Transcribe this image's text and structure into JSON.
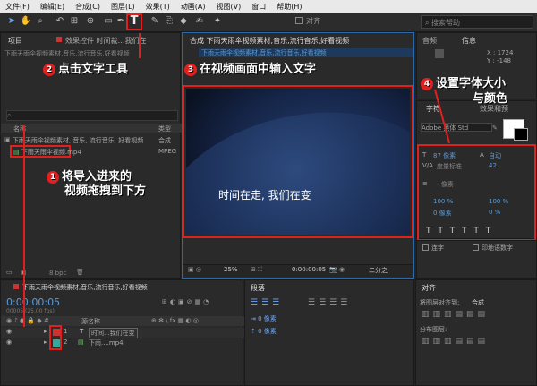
{
  "menu": [
    "文件(F)",
    "编辑(E)",
    "合成(C)",
    "图层(L)",
    "效果(T)",
    "动画(A)",
    "视图(V)",
    "窗口",
    "帮助(H)"
  ],
  "toolbar": {
    "align_label": "对齐",
    "search_placeholder": "搜索帮助"
  },
  "project_panel": {
    "tab": "项目",
    "effects_tab": "效果控件 时间裁…我们在",
    "comp_title": "下雨天雨伞视频素材,音乐,流行音乐,好看视频",
    "col_name": "名称",
    "col_type": "类型",
    "items": [
      {
        "name": "下雨天雨伞视频素材, 音乐, 流行音乐, 好看视频",
        "type": "合成"
      },
      {
        "name": "下雨天雨伞视频.mp4",
        "type": "MPEG"
      }
    ],
    "bpc": "8 bpc"
  },
  "composition_panel": {
    "tab": "合成 下雨天雨伞视频素材,音乐,流行音乐,好看视频",
    "subtab": "下雨天雨伞视频素材,音乐,流行音乐,好看视频",
    "video_text": "时间在走, 我们在变",
    "zoom": "25%",
    "timecode": "0:00:00:05",
    "quality": "二分之一"
  },
  "right_panels": {
    "audio_tab": "音频",
    "info_tab": "信息",
    "x_coord": "X : 1724",
    "y_coord": "Y : -148",
    "char_tab": "字符",
    "effects_tab": "效果和预",
    "font_family": "Adobe 黑体 Std",
    "font_size": "87 像素",
    "leading": "自动",
    "kerning": "度量标准",
    "tracking": "42",
    "stroke": "- 像素",
    "vscale": "100 %",
    "hscale": "100 %",
    "baseline": "0 像素",
    "tsume": "0 %",
    "ligature": "连字",
    "hindi": "印地语数字",
    "align_tab": "对齐",
    "align_to": "将图层对齐到:",
    "align_target": "合成",
    "distribute": "分布图层:"
  },
  "timeline": {
    "comp_tab": "下雨天雨伞视频素材,音乐,流行音乐,好看视频",
    "timecode": "0:00:00:05",
    "fps": "00005 (25.00 fps)",
    "col_source": "源名称",
    "layers": [
      {
        "num": "1",
        "name": "时间...我们在变"
      },
      {
        "num": "2",
        "name": "下雨....mp4"
      }
    ]
  },
  "paragraph_panel": {
    "tab": "段落"
  },
  "callouts": {
    "c1": "将导入进来的",
    "c1b": "视频拖拽到下方",
    "c2": "点击文字工具",
    "c3": "在视频画面中输入文字",
    "c4": "设置字体大小",
    "c4b": "与颜色",
    "n1": "1",
    "n2": "2",
    "n3": "3",
    "n4": "4"
  }
}
